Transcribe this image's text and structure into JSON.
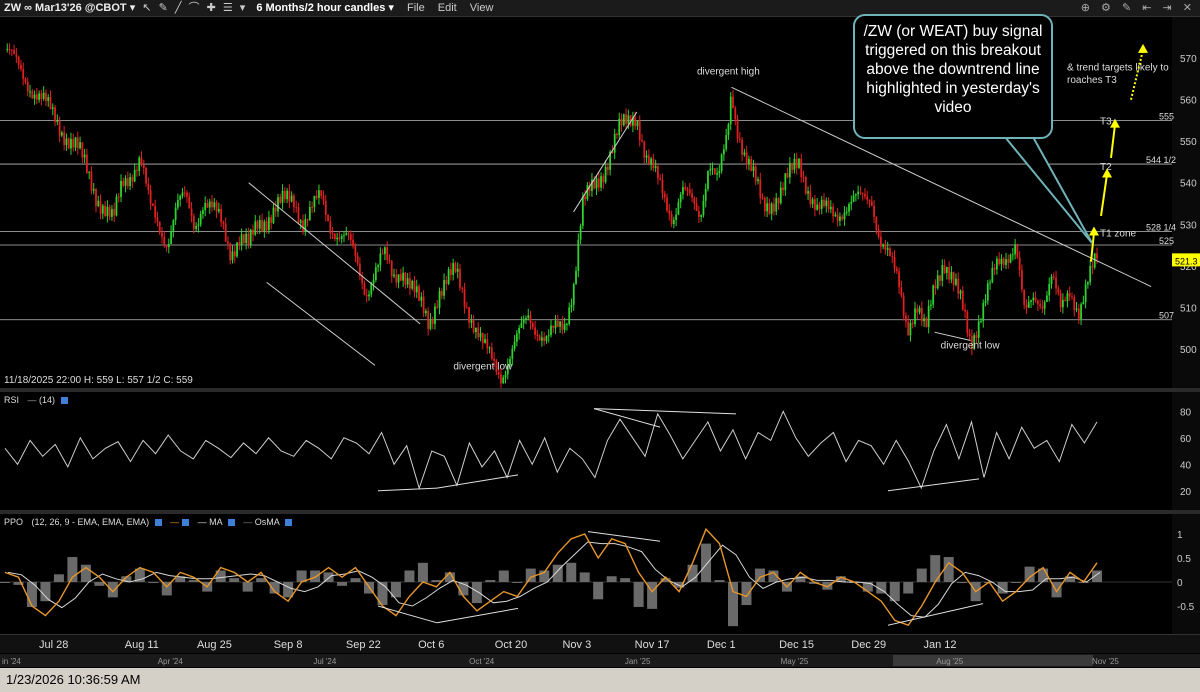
{
  "toolbar": {
    "symbol": "ZW ∞ Mar13'26 @CBOT ▾",
    "tool_icons": "↖ ✎ ╱ ⌒ ✚ ☰ ▾",
    "period": "6 Months/2 hour candles ▾",
    "menu_file": "File",
    "menu_edit": "Edit",
    "menu_view": "View",
    "right_icons": "⊕ ⚙ ✎ ⇤ ⇥ ✕"
  },
  "ohlc_readout": "11/18/2025 22:00   H: 559   L: 557 1/2   C: 559",
  "callout": {
    "text": "/ZW (or WEAT) buy signal triggered on this breakout above the downtrend line highlighted in yesterday's video"
  },
  "status_bar": {
    "timestamp": "1/23/2026 10:36:59 AM"
  },
  "colors": {
    "up_candle": "#2fd22f",
    "down_candle": "#e02020",
    "trendline": "#cfcfcf",
    "target_arrow": "#ffff00",
    "callout_border": "#6fb2b8",
    "ppo_line": "#e8962a"
  },
  "chart_data": [
    {
      "type": "candlestick",
      "timeframe": "6 Months/2 hour candles",
      "ylim": [
        492,
        578
      ],
      "yticks": [
        500,
        510,
        520,
        530,
        540,
        550,
        560,
        570
      ],
      "x_ticks": [
        "Jul 28",
        "Aug 11",
        "Aug 25",
        "Sep 8",
        "Sep 22",
        "Oct 6",
        "Oct 20",
        "Nov 3",
        "Nov 17",
        "Dec 1",
        "Dec 15",
        "Dec 29",
        "Jan 12"
      ],
      "x_ticks_overview": [
        "in '24",
        "Apr '24",
        "Jul '24",
        "Oct '24",
        "Jan '25",
        "May '25",
        "Aug '25",
        "Nov '25"
      ],
      "price_path": [
        [
          0,
          572
        ],
        [
          2,
          566
        ],
        [
          5,
          557
        ],
        [
          8,
          548
        ],
        [
          10,
          538
        ],
        [
          12,
          530
        ],
        [
          13,
          540
        ],
        [
          15,
          546
        ],
        [
          16,
          534
        ],
        [
          18,
          526
        ],
        [
          19,
          534
        ],
        [
          20,
          536
        ],
        [
          21,
          530
        ],
        [
          22,
          536
        ],
        [
          24,
          530
        ],
        [
          25,
          524
        ],
        [
          26,
          527
        ],
        [
          27,
          524
        ],
        [
          28,
          530
        ],
        [
          30,
          534
        ],
        [
          32,
          536
        ],
        [
          33,
          531
        ],
        [
          35,
          536
        ],
        [
          36,
          530
        ],
        [
          38,
          526
        ],
        [
          40,
          514
        ],
        [
          41,
          519
        ],
        [
          42,
          522
        ],
        [
          43,
          517
        ],
        [
          44,
          520
        ],
        [
          46,
          510
        ],
        [
          47,
          506
        ],
        [
          48,
          514
        ],
        [
          50,
          518
        ],
        [
          52,
          506
        ],
        [
          53,
          500
        ],
        [
          55,
          494
        ],
        [
          57,
          503
        ],
        [
          58,
          508
        ],
        [
          60,
          502
        ],
        [
          62,
          506
        ],
        [
          63,
          516
        ],
        [
          64,
          534
        ],
        [
          66,
          542
        ],
        [
          68,
          552
        ],
        [
          70,
          557
        ],
        [
          71,
          546
        ],
        [
          73,
          537
        ],
        [
          74,
          532
        ],
        [
          75,
          538
        ],
        [
          77,
          532
        ],
        [
          78,
          546
        ],
        [
          79,
          540
        ],
        [
          80,
          550
        ],
        [
          80.5,
          562
        ],
        [
          81,
          555
        ],
        [
          82,
          547
        ],
        [
          84,
          534
        ],
        [
          86,
          538
        ],
        [
          88,
          545
        ],
        [
          90,
          533
        ],
        [
          92,
          533
        ],
        [
          94,
          535
        ],
        [
          96,
          537
        ],
        [
          97,
          526
        ],
        [
          99,
          516
        ],
        [
          100,
          506
        ],
        [
          101,
          510
        ],
        [
          102,
          503
        ],
        [
          103,
          516
        ],
        [
          104,
          522
        ],
        [
          105,
          516
        ],
        [
          106,
          510
        ],
        [
          107,
          502
        ],
        [
          108,
          508
        ],
        [
          110,
          520
        ],
        [
          112,
          526
        ],
        [
          113,
          507
        ],
        [
          114,
          512
        ],
        [
          115,
          512
        ],
        [
          116,
          518
        ],
        [
          117,
          508
        ],
        [
          118,
          514
        ],
        [
          119,
          510
        ],
        [
          120,
          516
        ],
        [
          121,
          521
        ]
      ],
      "x_tick_index": [
        2,
        11.5,
        19.5,
        28,
        36,
        44,
        52.5,
        60,
        68,
        76,
        84,
        92,
        100
      ],
      "annotations": [
        {
          "text": "divergent high",
          "at": [
            80,
            567
          ]
        },
        {
          "text": "divergent low",
          "at": [
            53,
            496
          ]
        },
        {
          "text": "divergent low",
          "at": [
            107,
            501
          ]
        },
        {
          "text": "T1 zone",
          "at": [
            120,
            528
          ]
        },
        {
          "text": "T2",
          "at": [
            120,
            544
          ]
        },
        {
          "text": "T3",
          "at": [
            120,
            555
          ]
        },
        {
          "text": "& trend targets likely to",
          "at": [
            121,
            568
          ]
        },
        {
          "text": "roaches T3",
          "at": [
            121,
            565
          ]
        }
      ],
      "right_axis_labels": [
        {
          "text": "555",
          "value": 555
        },
        {
          "text": "544 1/2",
          "value": 544.5
        },
        {
          "text": "528 1/4",
          "value": 528.25
        },
        {
          "text": "525",
          "value": 525
        },
        {
          "text": "521.3",
          "value": 521.3
        },
        {
          "text": "507",
          "value": 507
        }
      ],
      "horizontal_levels": [
        555,
        544.5,
        528.25,
        525,
        507
      ],
      "last_price": 521.3,
      "last_price_label": "521.3"
    },
    {
      "type": "line",
      "name": "RSI",
      "label": "RSI",
      "param": "(14)",
      "ylim": [
        10,
        90
      ],
      "yticks": [
        20,
        40,
        60,
        80
      ],
      "values": [
        52,
        40,
        58,
        46,
        55,
        38,
        60,
        44,
        52,
        57,
        42,
        58,
        48,
        62,
        50,
        44,
        58,
        52,
        45,
        56,
        48,
        60,
        50,
        46,
        58,
        52,
        44,
        60,
        56,
        48,
        64,
        40,
        54,
        22,
        50,
        46,
        24,
        56,
        38,
        50,
        30,
        58,
        40,
        60,
        34,
        52,
        44,
        30,
        58,
        74,
        60,
        46,
        78,
        62,
        44,
        58,
        72,
        50,
        66,
        44,
        64,
        58,
        80,
        60,
        46,
        56,
        64,
        42,
        58,
        54,
        40,
        58,
        42,
        22,
        50,
        70,
        44,
        72,
        30,
        64,
        44,
        68,
        52,
        58,
        42,
        70,
        56,
        72
      ]
    },
    {
      "type": "line",
      "name": "PPO",
      "label": "PPO",
      "param": "(12, 26, 9 - EMA, EMA, EMA)",
      "legend_ma": "MA",
      "legend_osma": "OsMA",
      "ylim": [
        -1.0,
        1.25
      ],
      "yticks": [
        1.0,
        0.5,
        0.0,
        -0.5
      ],
      "values": [
        0.2,
        0.1,
        -0.5,
        -0.7,
        -0.4,
        0.1,
        0.3,
        0.1,
        -0.2,
        0.1,
        0.3,
        0.2,
        -0.1,
        0.2,
        0.1,
        -0.1,
        0.3,
        0.2,
        0.0,
        0.2,
        -0.2,
        -0.4,
        0.0,
        0.1,
        0.3,
        0.1,
        0.3,
        -0.1,
        -0.5,
        -0.7,
        -0.3,
        0.0,
        -0.1,
        0.2,
        -0.3,
        -0.6,
        -0.4,
        -0.2,
        -0.3,
        0.1,
        0.2,
        0.6,
        0.9,
        1.0,
        0.5,
        0.9,
        0.8,
        0.2,
        -0.2,
        0.1,
        -0.2,
        0.4,
        1.1,
        0.8,
        -0.2,
        -0.3,
        0.1,
        0.2,
        -0.1,
        0.2,
        0.0,
        -0.1,
        0.1,
        0.0,
        -0.2,
        -0.4,
        -0.8,
        -0.9,
        -0.5,
        0.0,
        0.4,
        0.2,
        -0.2,
        0.0,
        -0.4,
        -0.2,
        0.1,
        0.3,
        -0.2,
        0.2,
        0.0,
        0.4
      ]
    }
  ]
}
